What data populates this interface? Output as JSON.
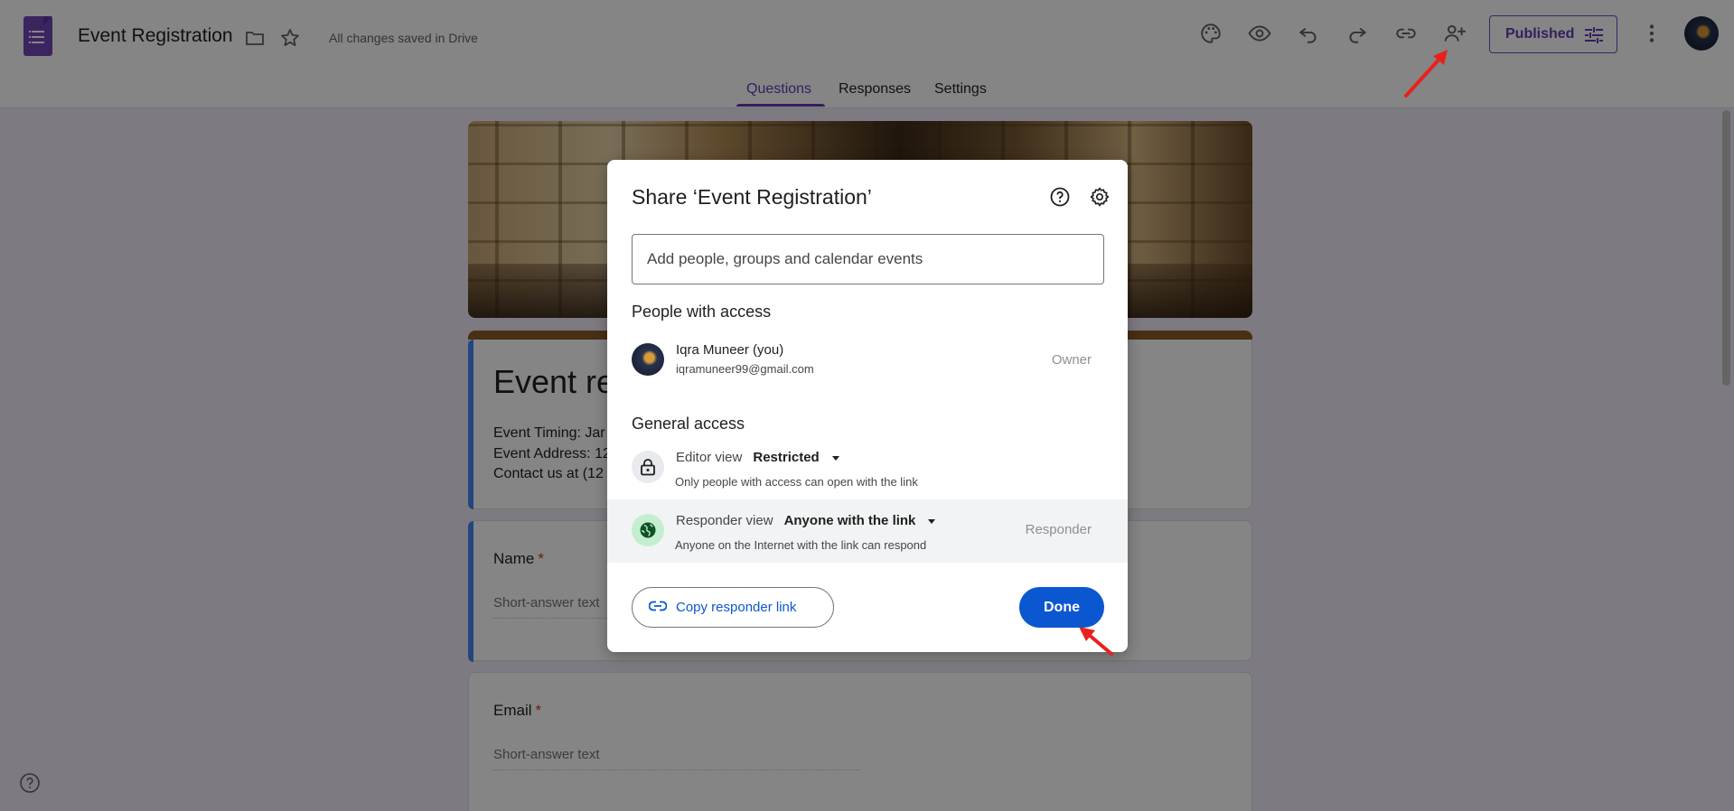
{
  "app": {
    "doc_title": "Event Registration",
    "save_status": "All changes saved in Drive",
    "published_label": "Published"
  },
  "tabs": [
    {
      "label": "Questions",
      "active": true
    },
    {
      "label": "Responses",
      "active": false
    },
    {
      "label": "Settings",
      "active": false
    }
  ],
  "form": {
    "title_partial": "Event re",
    "description_lines": [
      "Event Timing: Jar",
      "Event Address: 12",
      "Contact us at (12"
    ],
    "questions": [
      {
        "label": "Name",
        "required_mark": "*",
        "placeholder": "Short-answer text"
      },
      {
        "label": "Email",
        "required_mark": "*",
        "placeholder": "Short-answer text"
      }
    ]
  },
  "share_dialog": {
    "title": "Share ‘Event Registration’",
    "add_placeholder": "Add people, groups and calendar events",
    "people_heading": "People with access",
    "person": {
      "name": "Iqra Muneer (you)",
      "email": "iqramuneer99@gmail.com",
      "role": "Owner"
    },
    "general_heading": "General access",
    "editor": {
      "label": "Editor view",
      "value": "Restricted",
      "description": "Only people with access can open with the link"
    },
    "responder": {
      "label": "Responder view",
      "value": "Anyone with the link",
      "description": "Anyone on the Internet with the link can respond",
      "role": "Responder"
    },
    "copy_link_label": "Copy responder link",
    "done_label": "Done"
  },
  "colors": {
    "brand_purple": "#673ab7",
    "accent_blue": "#0b57d0",
    "annotation_red": "#e8211c"
  },
  "icons": [
    "palette-icon",
    "eye-icon",
    "undo-icon",
    "redo-icon",
    "link-icon",
    "add-person-icon",
    "tune-icon",
    "more-vert-icon",
    "folder-icon",
    "star-icon",
    "help-icon",
    "gear-icon",
    "lock-icon",
    "globe-icon"
  ]
}
